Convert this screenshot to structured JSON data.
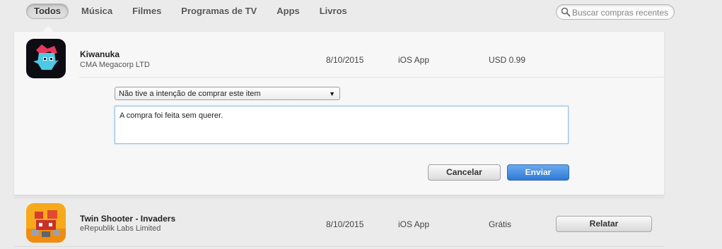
{
  "tabs": [
    {
      "label": "Todos",
      "active": true
    },
    {
      "label": "Música",
      "active": false
    },
    {
      "label": "Filmes",
      "active": false
    },
    {
      "label": "Programas de TV",
      "active": false
    },
    {
      "label": "Apps",
      "active": false
    },
    {
      "label": "Livros",
      "active": false
    }
  ],
  "search": {
    "placeholder": "Buscar compras recentes",
    "icon": "search-icon"
  },
  "purchases": [
    {
      "name": "Kiwanuka",
      "developer": "CMA Megacorp LTD",
      "date": "8/10/2015",
      "type": "iOS App",
      "price": "USD 0.99",
      "icon": "kiwanuka-app-icon"
    },
    {
      "name": "Twin Shooter - Invaders",
      "developer": "eRepublik Labs Limited",
      "date": "8/10/2015",
      "type": "iOS App",
      "price": "Grátis",
      "icon": "twin-shooter-app-icon",
      "action_label": "Relatar"
    }
  ],
  "report_form": {
    "reason_selected": "Não tive a intenção de comprar este item",
    "comment": "A compra foi feita sem querer.",
    "cancel_label": "Cancelar",
    "send_label": "Enviar"
  },
  "colors": {
    "accent": "#3a82db",
    "background": "#ebebeb",
    "panel": "#f7f7f7"
  }
}
